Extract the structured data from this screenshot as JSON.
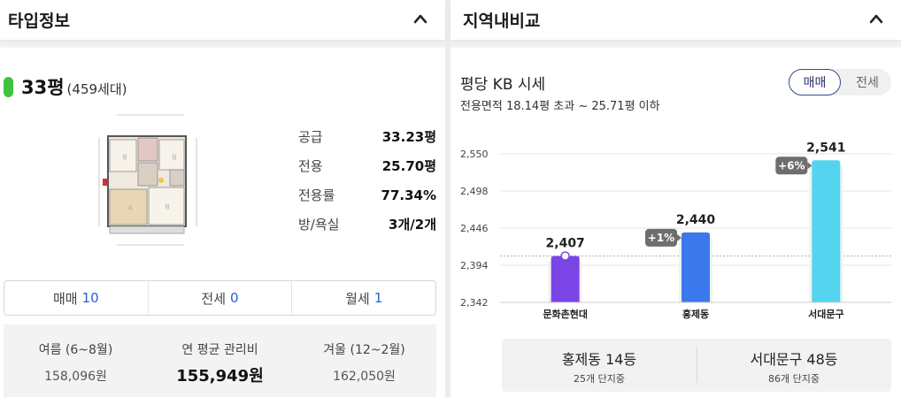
{
  "left_panel": {
    "title": "타입정보",
    "type": {
      "pyeong": "33평",
      "households": "(459세대)"
    },
    "specs": [
      {
        "label": "공급",
        "value": "33.23평"
      },
      {
        "label": "전용",
        "value": "25.70평"
      },
      {
        "label": "전용률",
        "value": "77.34%"
      },
      {
        "label": "방/욕실",
        "value": "3개/2개"
      }
    ],
    "tabs": [
      {
        "label": "매매",
        "count": "10"
      },
      {
        "label": "전세",
        "count": "0"
      },
      {
        "label": "월세",
        "count": "1"
      }
    ],
    "fees": [
      {
        "label": "여름 (6~8월)",
        "value": "158,096원"
      },
      {
        "label": "연 평균 관리비",
        "value": "155,949원"
      },
      {
        "label": "겨울 (12~2월)",
        "value": "162,050원"
      }
    ]
  },
  "right_panel": {
    "title": "지역내비교",
    "kb_title": "평당 KB 시세",
    "kb_subtitle": "전용면적 18.14평 초과 ~ 25.71평 이하",
    "toggle": {
      "active": "매매",
      "inactive": "전세"
    },
    "ranks": [
      {
        "main": "홍제동 14등",
        "sub": "25개 단지중"
      },
      {
        "main": "서대문구 48등",
        "sub": "86개 단지중"
      }
    ]
  },
  "icons": {
    "collapse": "chevron-up-icon",
    "floorplan": "floorplan-image"
  },
  "colors": {
    "accent_green": "#3fc23f",
    "link_blue": "#2962d6",
    "bar_purple": "#7b45e6",
    "bar_blue": "#3b78ec",
    "bar_cyan": "#55d4f0",
    "badge_gray": "#6e6e6e",
    "toggle_border": "#334a8a"
  },
  "chart_data": {
    "type": "bar",
    "categories": [
      "문화촌현대",
      "홍제동",
      "서대문구"
    ],
    "values": [
      2407,
      2440,
      2541
    ],
    "value_labels": [
      "2,407",
      "2,440",
      "2,541"
    ],
    "badges": [
      null,
      "+1%",
      "+6%"
    ],
    "y_ticks": [
      2342,
      2394,
      2446,
      2498,
      2550
    ],
    "y_tick_labels": [
      "2,342",
      "2,394",
      "2,446",
      "2,498",
      "2,550"
    ],
    "ylim": [
      2342,
      2550
    ],
    "reference_value": 2407,
    "grid": true,
    "colors": [
      "#7b45e6",
      "#3b78ec",
      "#55d4f0"
    ]
  }
}
